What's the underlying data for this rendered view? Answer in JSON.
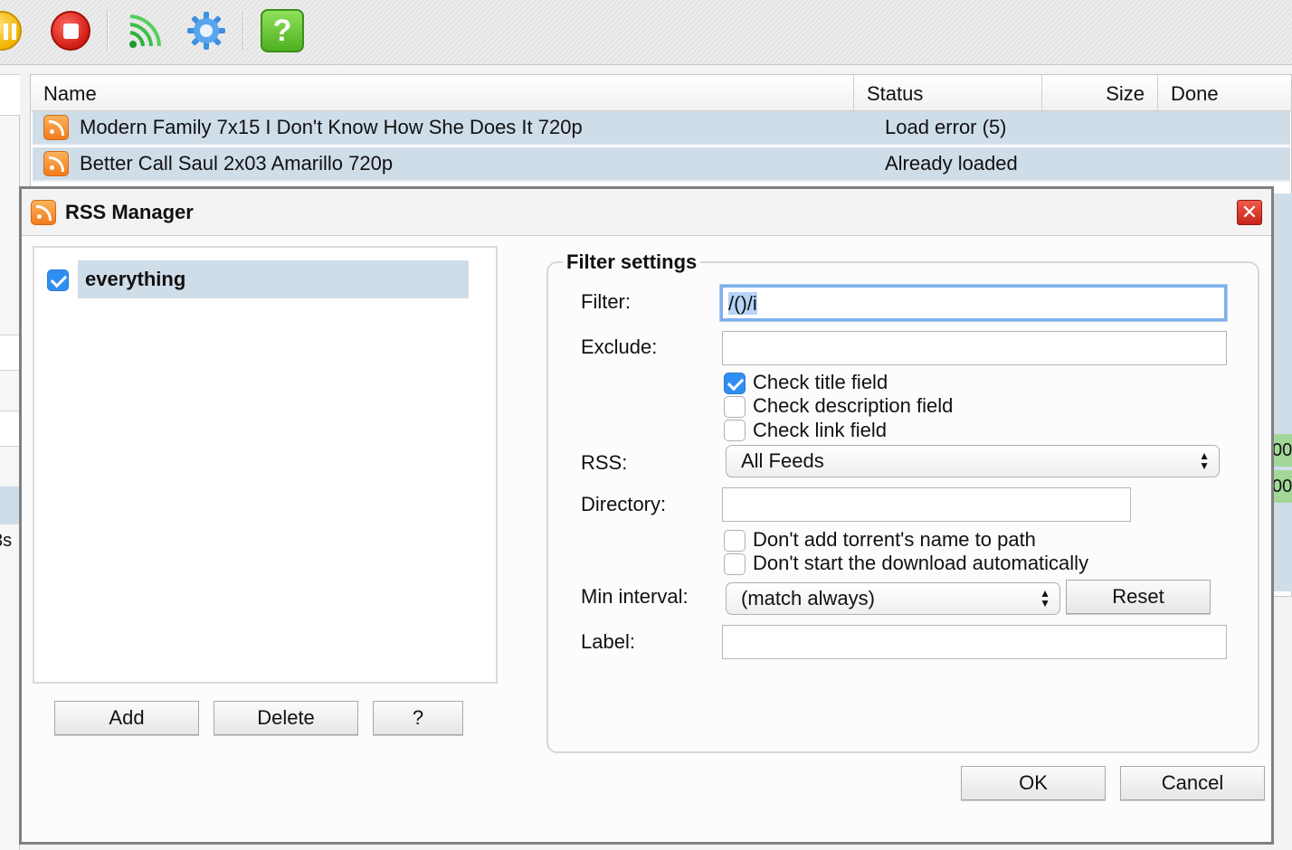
{
  "toolbar": {
    "buttons": [
      {
        "icon": "pause-icon"
      },
      {
        "icon": "stop-icon"
      },
      {
        "icon": "rss-feeds-icon"
      },
      {
        "icon": "settings-gear-icon"
      },
      {
        "icon": "help-icon",
        "glyph": "?"
      }
    ]
  },
  "left_panel": {
    "partial_text": "3s"
  },
  "torrent_table": {
    "columns": [
      "Name",
      "Status",
      "Size",
      "Done"
    ],
    "rows": [
      {
        "name": "Modern Family 7x15 I Don't Know How She Does It 720p",
        "status": "Load error (5)"
      },
      {
        "name": "Better Call Saul 2x03 Amarillo 720p",
        "status": "Already loaded"
      }
    ],
    "right_partial": [
      "00",
      "00"
    ]
  },
  "dialog": {
    "title": "RSS Manager",
    "close_glyph": "✕",
    "filters": [
      {
        "label": "everything",
        "checked": true
      }
    ],
    "buttons": {
      "add": "Add",
      "delete": "Delete",
      "help": "?",
      "ok": "OK",
      "cancel": "Cancel"
    },
    "settings": {
      "legend": "Filter settings",
      "filter_label": "Filter:",
      "filter_value": "/()/i",
      "exclude_label": "Exclude:",
      "exclude_value": "",
      "check_title": "Check title field",
      "check_description": "Check description field",
      "check_link": "Check link field",
      "rss_label": "RSS:",
      "rss_value": "All Feeds",
      "directory_label": "Directory:",
      "directory_value": "",
      "no_name_path": "Don't add torrent's name to path",
      "no_autostart": "Don't start the download automatically",
      "interval_label": "Min interval:",
      "interval_value": "(match always)",
      "reset": "Reset",
      "label_label": "Label:",
      "label_value": ""
    }
  }
}
